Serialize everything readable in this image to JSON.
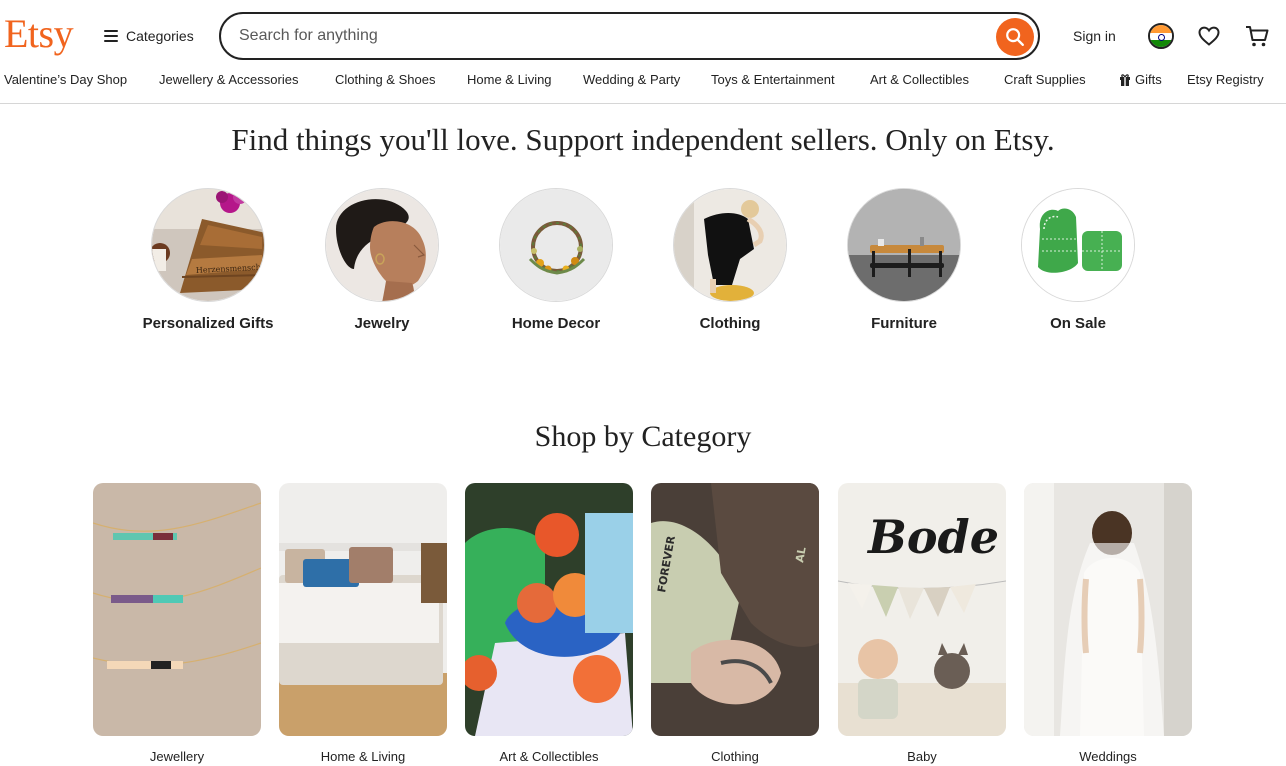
{
  "header": {
    "logo": "Etsy",
    "categories_label": "Categories",
    "search_placeholder": "Search for anything",
    "signin_label": "Sign in"
  },
  "category_nav": [
    {
      "label": "Valentine’s Day Shop"
    },
    {
      "label": "Jewellery & Accessories"
    },
    {
      "label": "Clothing & Shoes"
    },
    {
      "label": "Home & Living"
    },
    {
      "label": "Wedding & Party"
    },
    {
      "label": "Toys & Entertainment"
    },
    {
      "label": "Art & Collectibles"
    },
    {
      "label": "Craft Supplies"
    },
    {
      "label": "Gifts"
    },
    {
      "label": "Etsy Registry"
    }
  ],
  "hero": {
    "title": "Find things you'll love. Support independent sellers. Only on Etsy."
  },
  "circles": [
    {
      "label": "Personalized Gifts"
    },
    {
      "label": "Jewelry"
    },
    {
      "label": "Home Decor"
    },
    {
      "label": "Clothing"
    },
    {
      "label": "Furniture"
    },
    {
      "label": "On Sale"
    }
  ],
  "shop_by_category": {
    "title": "Shop by Category",
    "cards": [
      {
        "label": "Jewellery"
      },
      {
        "label": "Home & Living"
      },
      {
        "label": "Art & Collectibles"
      },
      {
        "label": "Clothing"
      },
      {
        "label": "Baby"
      },
      {
        "label": "Weddings"
      }
    ]
  },
  "image_text": {
    "board_engraving": "Herzensmensch",
    "sleeve_text": "FOREVER",
    "sleeve_text_2": "AL",
    "sign_name": "Bode"
  },
  "colors": {
    "brand_orange": "#F1641E",
    "text": "#222222"
  }
}
